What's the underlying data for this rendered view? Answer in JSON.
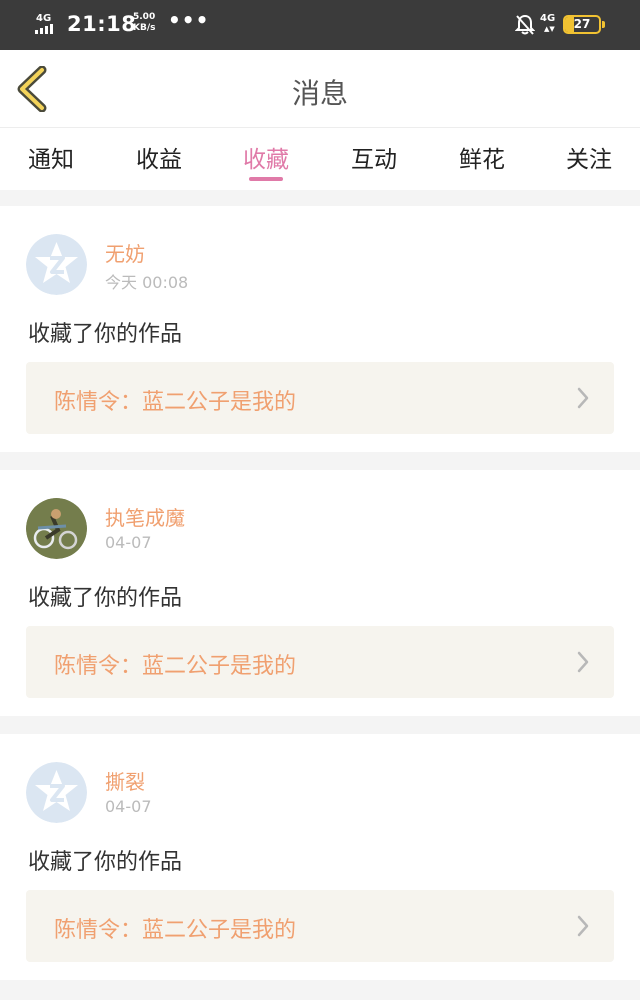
{
  "status_bar": {
    "network": "4G",
    "time": "21:18",
    "speed_value": "5.00",
    "speed_unit": "KB/s",
    "more": "•••",
    "network_right": "4G",
    "battery": "27"
  },
  "header": {
    "title": "消息"
  },
  "tabs": [
    {
      "label": "通知"
    },
    {
      "label": "收益"
    },
    {
      "label": "收藏"
    },
    {
      "label": "互动"
    },
    {
      "label": "鲜花"
    },
    {
      "label": "关注"
    }
  ],
  "active_tab": "收藏",
  "messages": [
    {
      "user": "无妨",
      "time": "今天 00:08",
      "action": "收藏了你的作品",
      "work": "陈情令：蓝二公子是我的"
    },
    {
      "user": "执笔成魔",
      "time": "04-07",
      "action": "收藏了你的作品",
      "work": "陈情令：蓝二公子是我的"
    },
    {
      "user": "撕裂",
      "time": "04-07",
      "action": "收藏了你的作品",
      "work": "陈情令：蓝二公子是我的"
    }
  ],
  "colors": {
    "accent_pink": "#e07aa8",
    "username_orange": "#f0a070",
    "status_bar_bg": "#3b3b3b",
    "link_bg": "#f6f4ee"
  }
}
